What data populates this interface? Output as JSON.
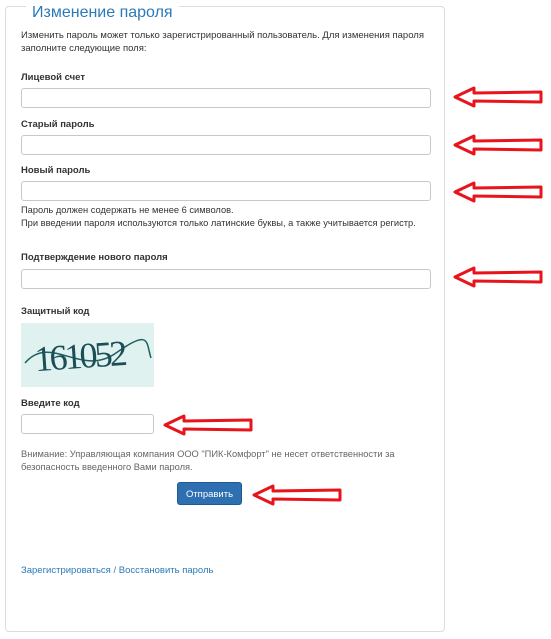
{
  "header": {
    "title": "Изменение пароля"
  },
  "intro": "Изменить пароль может только зарегистрированный пользователь. Для изменения пароля заполните следующие поля:",
  "fields": {
    "account": {
      "label": "Лицевой счет",
      "value": ""
    },
    "old_password": {
      "label": "Старый пароль",
      "value": ""
    },
    "new_password": {
      "label": "Новый пароль",
      "value": "",
      "help_1": "Пароль должен содержать не менее 6 символов.",
      "help_2": "При введении пароля используются только латинские буквы, а также учитывается регистр."
    },
    "confirm_password": {
      "label": "Подтверждение нового пароля",
      "value": ""
    }
  },
  "captcha": {
    "label": "Защитный код",
    "image_text": "161052"
  },
  "code": {
    "label": "Введите код",
    "value": ""
  },
  "note": "Внимание: Управляющая компания ООО \"ПИК-Комфорт\" не несет ответственности за безопасность введенного Вами пароля.",
  "submit_label": "Отправить",
  "links": {
    "register": "Зарегистрироваться",
    "separator": " / ",
    "restore": "Восстановить пароль"
  },
  "colors": {
    "accent": "#2a7ab8",
    "button": "#2d6fb0",
    "arrow": "#e8141b",
    "captcha_bg": "#dff2f0"
  }
}
